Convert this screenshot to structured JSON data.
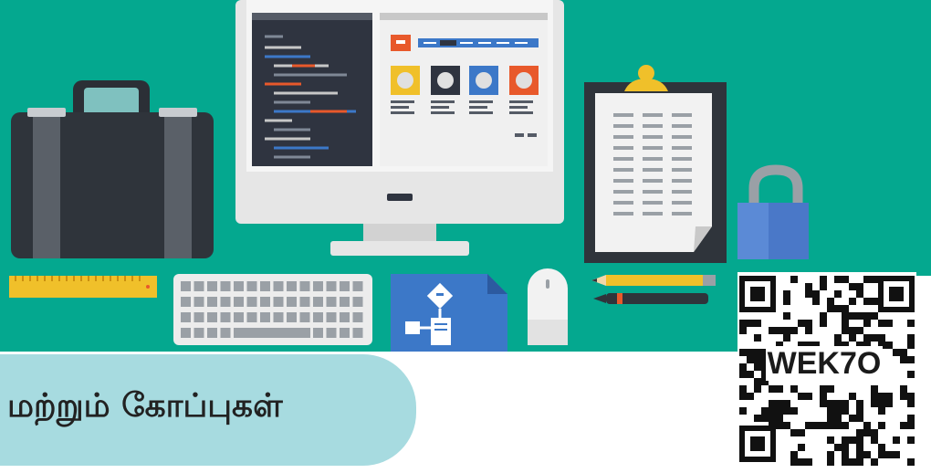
{
  "title": "மற்றும் கோப்புகள்",
  "qr_code_text": "WEK7O",
  "colors": {
    "background": "#04a88f",
    "title_pill": "#a7dbe0",
    "monitor_frame": "#e6e6e6",
    "code_editor": "#2f3440",
    "accent_orange": "#e8592b",
    "accent_blue": "#3c78c8",
    "accent_yellow": "#f0c02a"
  },
  "icons": [
    "briefcase-icon",
    "computer-monitor-icon",
    "clipboard-icon",
    "padlock-icon",
    "ruler-icon",
    "keyboard-icon",
    "flowchart-document-icon",
    "mouse-icon",
    "pencil-icon",
    "pen-icon",
    "qr-code-icon"
  ]
}
